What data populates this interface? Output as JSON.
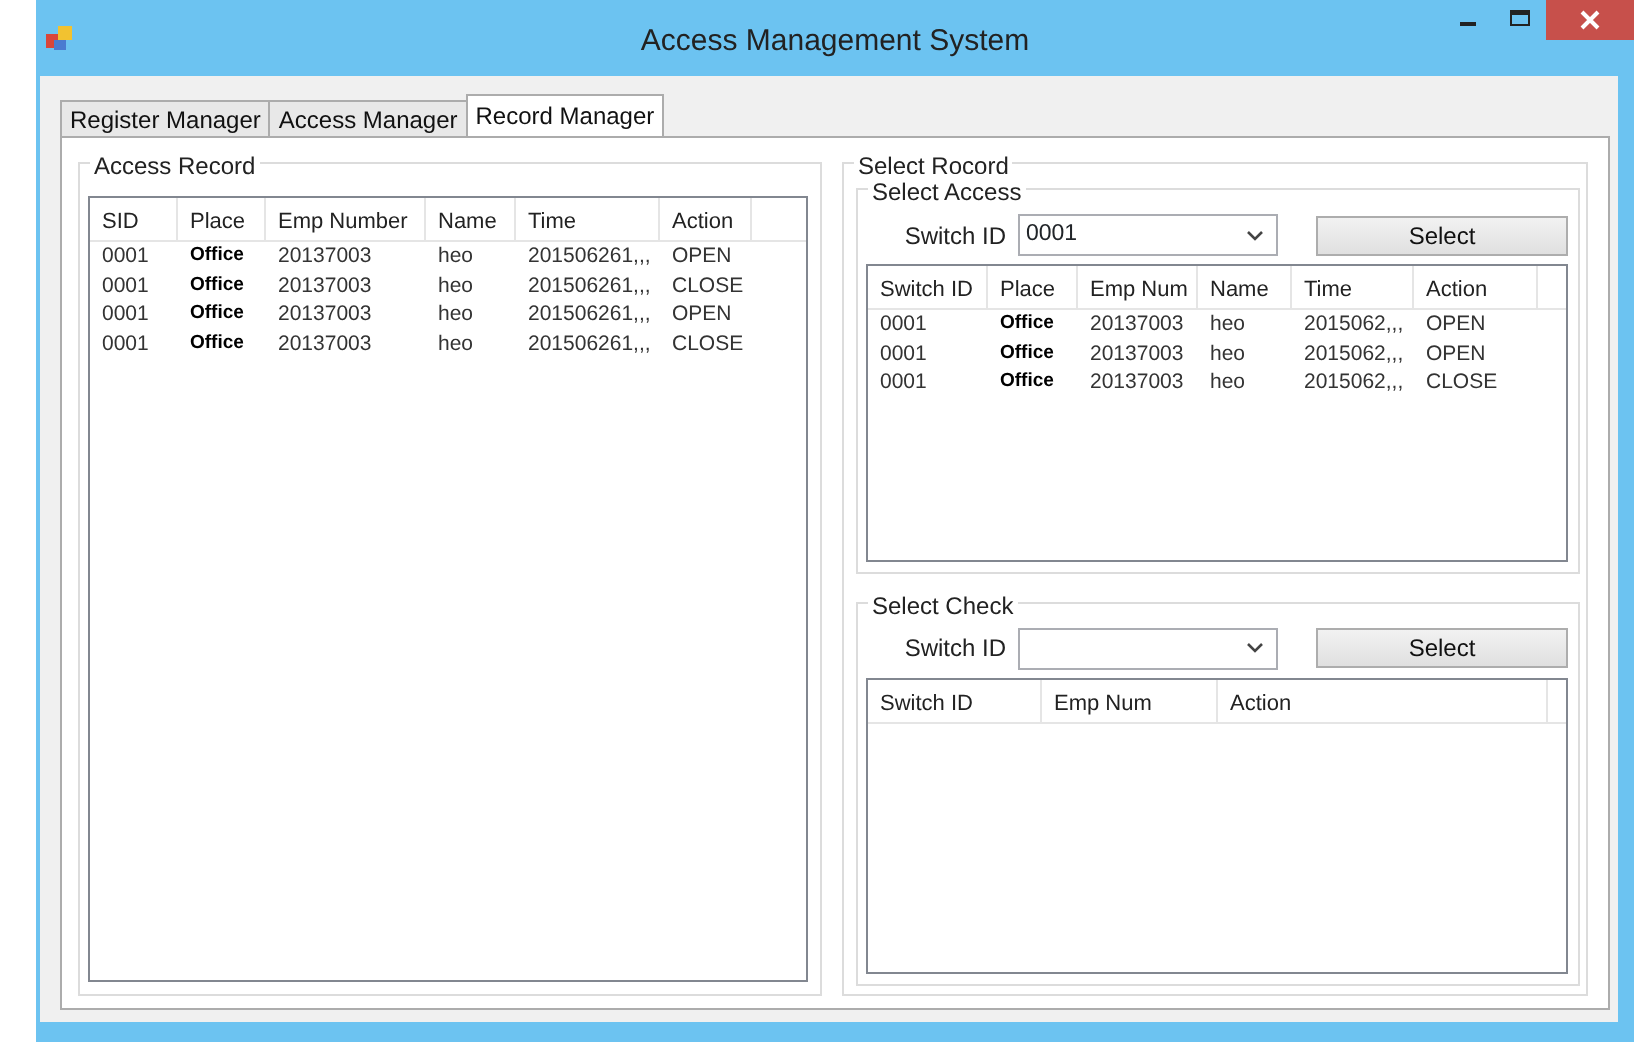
{
  "window": {
    "title": "Access Management System"
  },
  "tabs": [
    {
      "label": "Register Manager",
      "selected": false
    },
    {
      "label": "Access Manager",
      "selected": false
    },
    {
      "label": "Record Manager",
      "selected": true
    }
  ],
  "access_record": {
    "title": "Access Record",
    "columns": [
      "SID",
      "Place",
      "Emp Number",
      "Name",
      "Time",
      "Action"
    ],
    "rows": [
      [
        "0001",
        "Office",
        "20137003",
        "heo",
        "201506261,,,",
        "OPEN"
      ],
      [
        "0001",
        "Office",
        "20137003",
        "heo",
        "201506261,,,",
        "CLOSE"
      ],
      [
        "0001",
        "Office",
        "20137003",
        "heo",
        "201506261,,,",
        "OPEN"
      ],
      [
        "0001",
        "Office",
        "20137003",
        "heo",
        "201506261,,,",
        "CLOSE"
      ]
    ]
  },
  "select_record": {
    "title": "Select Rocord",
    "select_access": {
      "title": "Select Access",
      "switch_label": "Switch ID",
      "switch_value": "0001",
      "button": "Select",
      "columns": [
        "Switch ID",
        "Place",
        "Emp Num",
        "Name",
        "Time",
        "Action"
      ],
      "rows": [
        [
          "0001",
          "Office",
          "20137003",
          "heo",
          "2015062,,,",
          "OPEN"
        ],
        [
          "0001",
          "Office",
          "20137003",
          "heo",
          "2015062,,,",
          "OPEN"
        ],
        [
          "0001",
          "Office",
          "20137003",
          "heo",
          "2015062,,,",
          "CLOSE"
        ]
      ]
    },
    "select_check": {
      "title": "Select Check",
      "switch_label": "Switch ID",
      "button": "Select",
      "columns": [
        "Switch ID",
        "Emp Num",
        "Action"
      ]
    }
  }
}
